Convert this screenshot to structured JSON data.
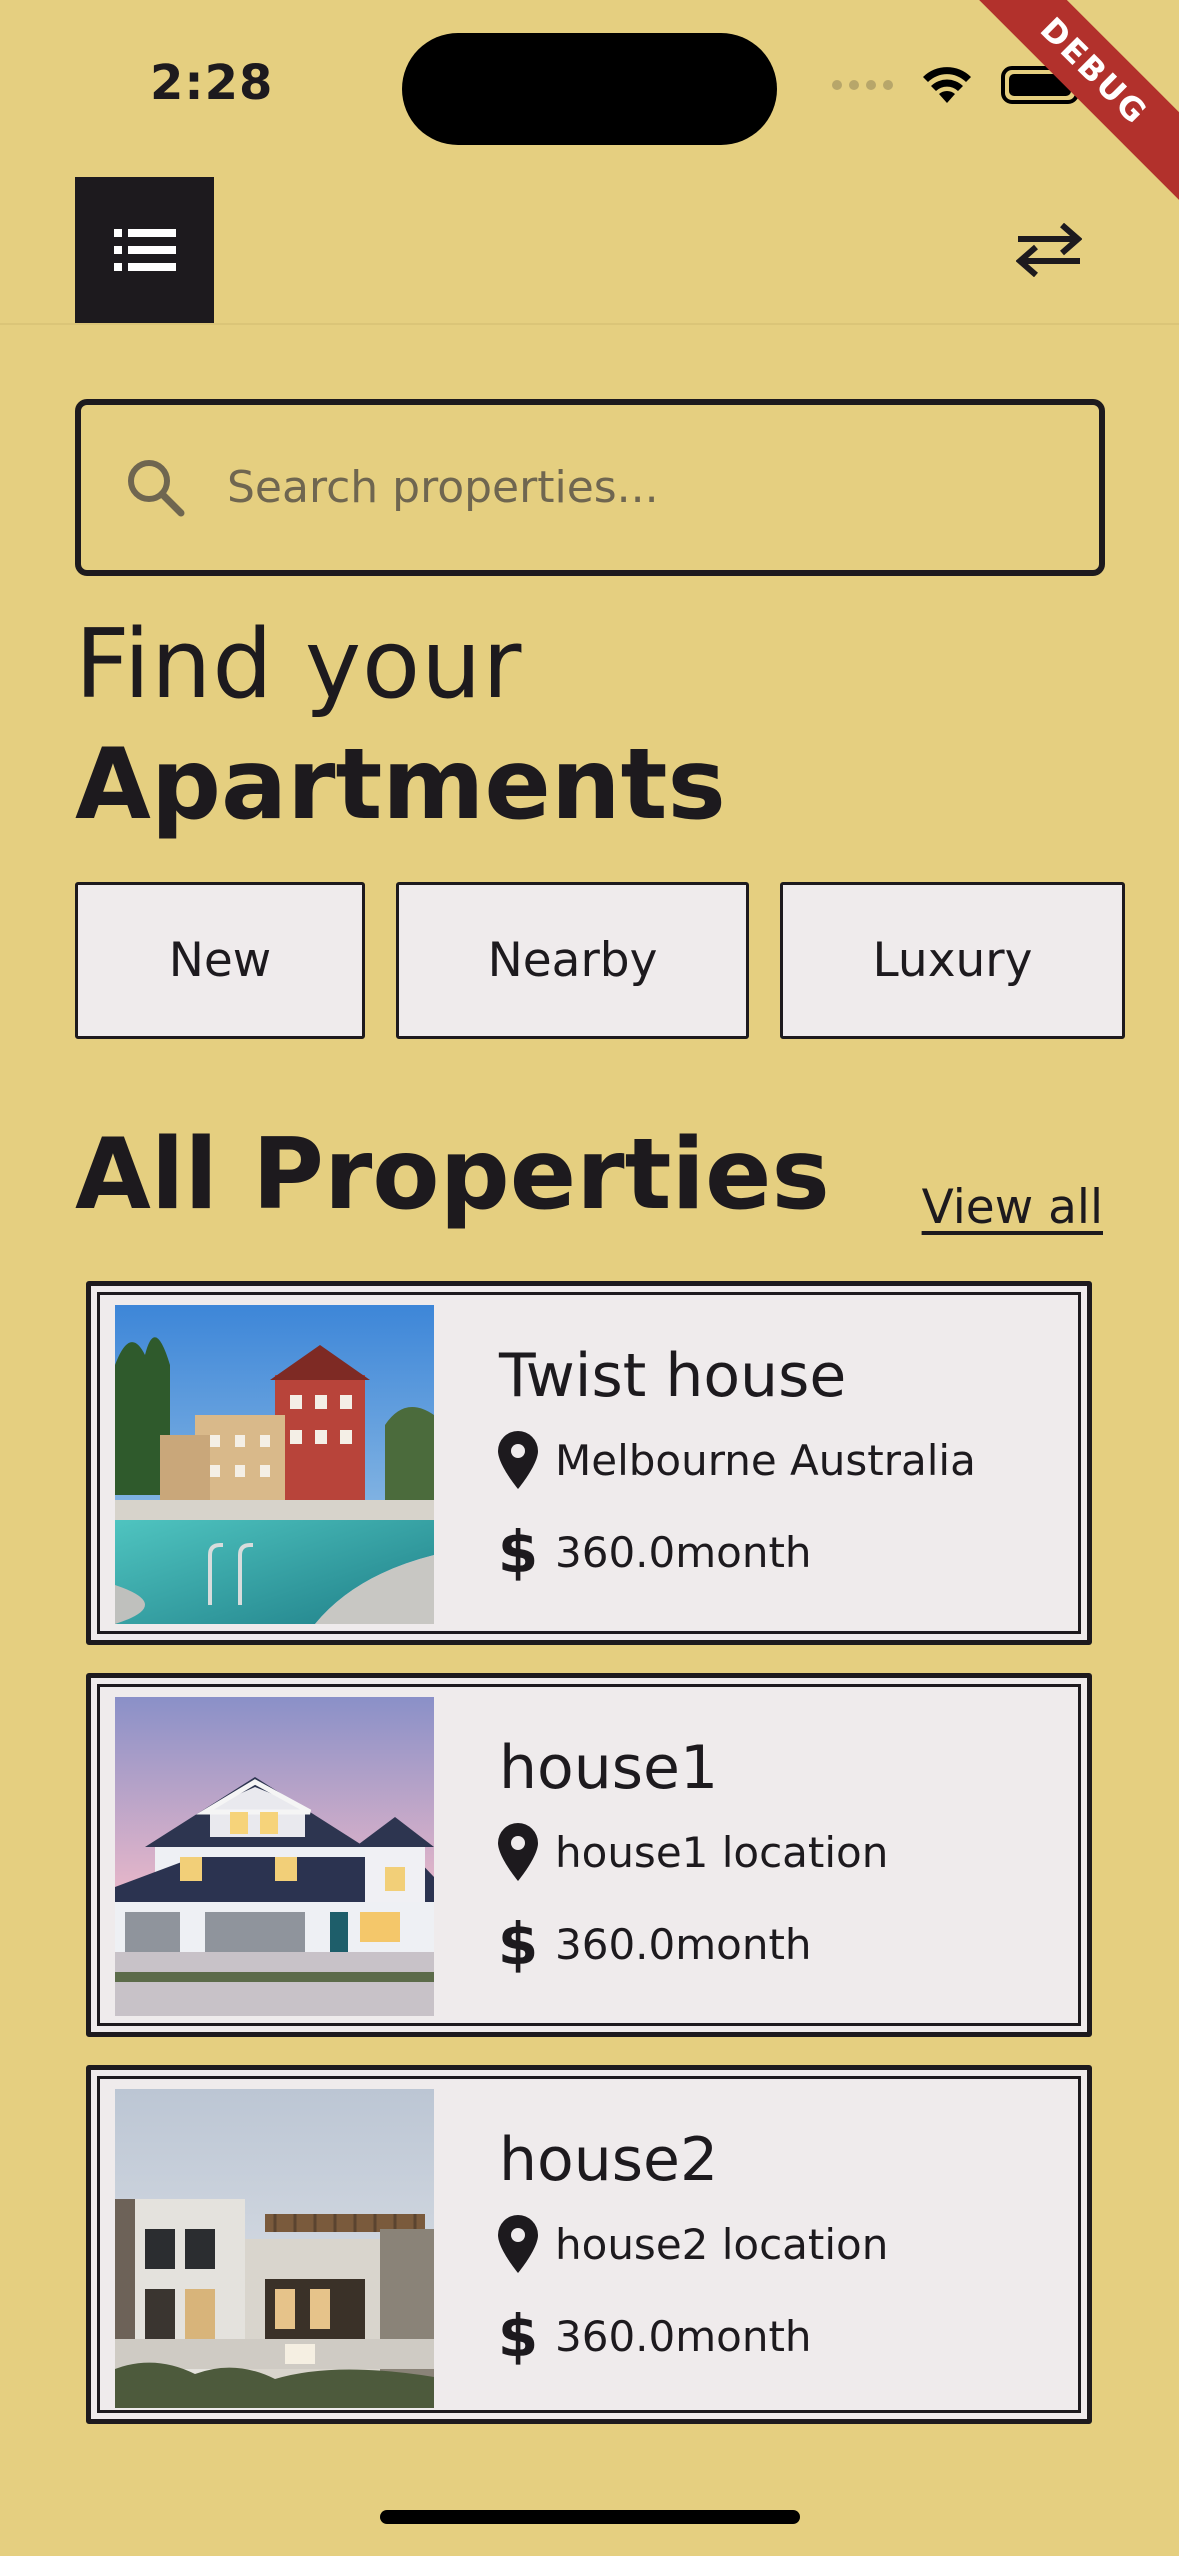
{
  "status_bar": {
    "time": "2:28"
  },
  "debug_banner": "DEBUG",
  "search": {
    "placeholder": "Search properties..."
  },
  "heading": {
    "line1": "Find your",
    "line2": "Apartments"
  },
  "filters": [
    "New",
    "Nearby",
    "Luxury"
  ],
  "section": {
    "title": "All Properties",
    "view_all": "View all"
  },
  "properties": [
    {
      "name": "Twist house",
      "location": "Melbourne Australia",
      "price": "360.0month",
      "image": "apartment-complex-with-pool"
    },
    {
      "name": "house1",
      "location": "house1 location",
      "price": "360.0month",
      "image": "suburban-house-at-dusk"
    },
    {
      "name": "house2",
      "location": "house2 location",
      "price": "360.0month",
      "image": "modern-villa-with-pergola"
    }
  ],
  "icons": {
    "menu": "list-icon",
    "swap": "swap-arrows-icon",
    "search": "search-icon",
    "location": "location-pin-icon",
    "price": "dollar-icon"
  },
  "colors": {
    "background": "#e5cf80",
    "dark": "#1d1a1e",
    "card": "#efebec",
    "ribbon": "#b2312c"
  }
}
